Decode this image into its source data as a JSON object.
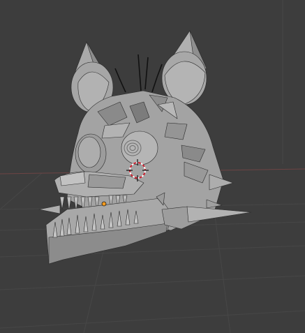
{
  "viewport": {
    "type": "3d-viewport",
    "mode": "solid-shading",
    "background_color": "#3d3d3d",
    "grid_color": "#4a4a4a",
    "axis_x_color": "#7a4a4a",
    "object_color": "#a3a3a3",
    "object_shadow_color": "#7c7c7c",
    "object_highlight_color": "#bdbdbd",
    "edge_color": "#1a1a1a",
    "origin_color": "#f29a1f",
    "cursor_color": "#c8202f"
  },
  "scene": {
    "object": {
      "name_icon": "animatronic-fox-head-mesh",
      "selected": false
    },
    "cursor_icon": "3d-cursor-icon",
    "origin_icon": "object-origin-icon"
  }
}
